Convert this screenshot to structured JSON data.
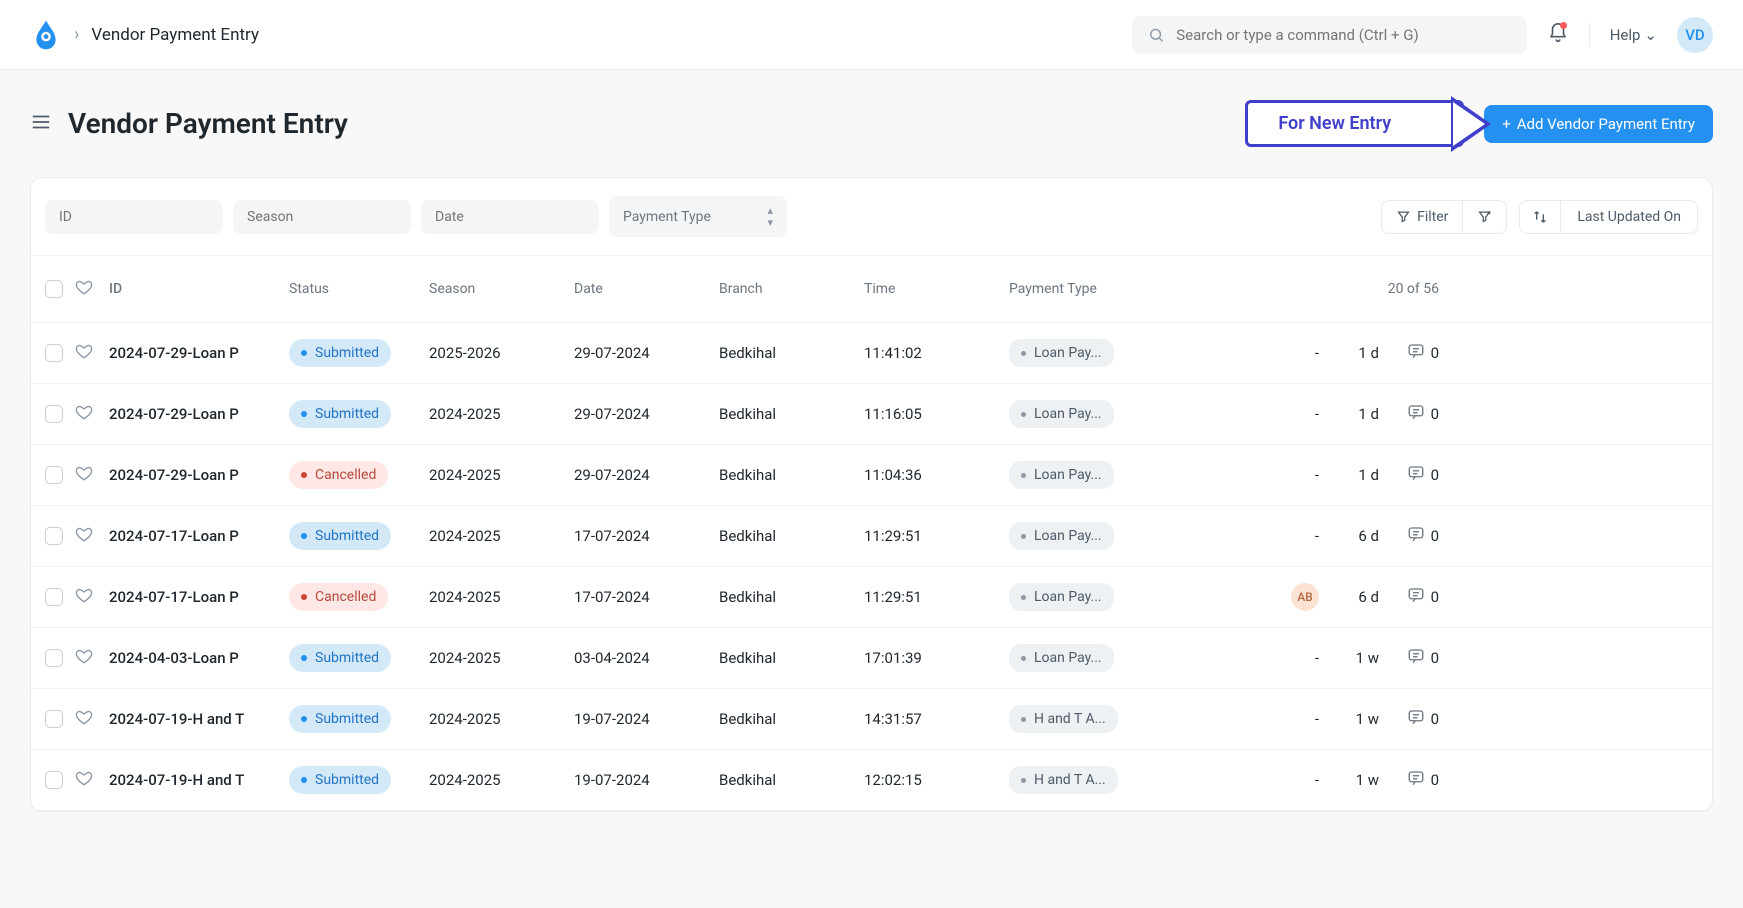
{
  "breadcrumb": {
    "title": "Vendor Payment Entry"
  },
  "search": {
    "placeholder": "Search or type a command (Ctrl + G)"
  },
  "help": {
    "label": "Help"
  },
  "avatar": {
    "initials": "VD"
  },
  "page": {
    "title": "Vendor Payment Entry",
    "annotation": "For New Entry",
    "add_button": "Add Vendor Payment Entry"
  },
  "filters": {
    "id_placeholder": "ID",
    "season_placeholder": "Season",
    "date_placeholder": "Date",
    "ptype_placeholder": "Payment Type",
    "filter_label": "Filter",
    "sort_label": "Last Updated On"
  },
  "columns": {
    "id": "ID",
    "status": "Status",
    "season": "Season",
    "date": "Date",
    "branch": "Branch",
    "time": "Time",
    "ptype": "Payment Type",
    "count": "20 of 56"
  },
  "rows": [
    {
      "id": "2024-07-29-Loan P",
      "status": "Submitted",
      "season": "2025-2026",
      "date": "29-07-2024",
      "branch": "Bedkihal",
      "time": "11:41:02",
      "ptype": "Loan Pay...",
      "avatar": "-",
      "updated": "1 d",
      "comments": "0"
    },
    {
      "id": "2024-07-29-Loan P",
      "status": "Submitted",
      "season": "2024-2025",
      "date": "29-07-2024",
      "branch": "Bedkihal",
      "time": "11:16:05",
      "ptype": "Loan Pay...",
      "avatar": "-",
      "updated": "1 d",
      "comments": "0"
    },
    {
      "id": "2024-07-29-Loan P",
      "status": "Cancelled",
      "season": "2024-2025",
      "date": "29-07-2024",
      "branch": "Bedkihal",
      "time": "11:04:36",
      "ptype": "Loan Pay...",
      "avatar": "-",
      "updated": "1 d",
      "comments": "0"
    },
    {
      "id": "2024-07-17-Loan P",
      "status": "Submitted",
      "season": "2024-2025",
      "date": "17-07-2024",
      "branch": "Bedkihal",
      "time": "11:29:51",
      "ptype": "Loan Pay...",
      "avatar": "-",
      "updated": "6 d",
      "comments": "0"
    },
    {
      "id": "2024-07-17-Loan P",
      "status": "Cancelled",
      "season": "2024-2025",
      "date": "17-07-2024",
      "branch": "Bedkihal",
      "time": "11:29:51",
      "ptype": "Loan Pay...",
      "avatar": "AB",
      "updated": "6 d",
      "comments": "0"
    },
    {
      "id": "2024-04-03-Loan P",
      "status": "Submitted",
      "season": "2024-2025",
      "date": "03-04-2024",
      "branch": "Bedkihal",
      "time": "17:01:39",
      "ptype": "Loan Pay...",
      "avatar": "-",
      "updated": "1 w",
      "comments": "0"
    },
    {
      "id": "2024-07-19-H and T",
      "status": "Submitted",
      "season": "2024-2025",
      "date": "19-07-2024",
      "branch": "Bedkihal",
      "time": "14:31:57",
      "ptype": "H and T A...",
      "avatar": "-",
      "updated": "1 w",
      "comments": "0"
    },
    {
      "id": "2024-07-19-H and T",
      "status": "Submitted",
      "season": "2024-2025",
      "date": "19-07-2024",
      "branch": "Bedkihal",
      "time": "12:02:15",
      "ptype": "H and T A...",
      "avatar": "-",
      "updated": "1 w",
      "comments": "0"
    }
  ]
}
